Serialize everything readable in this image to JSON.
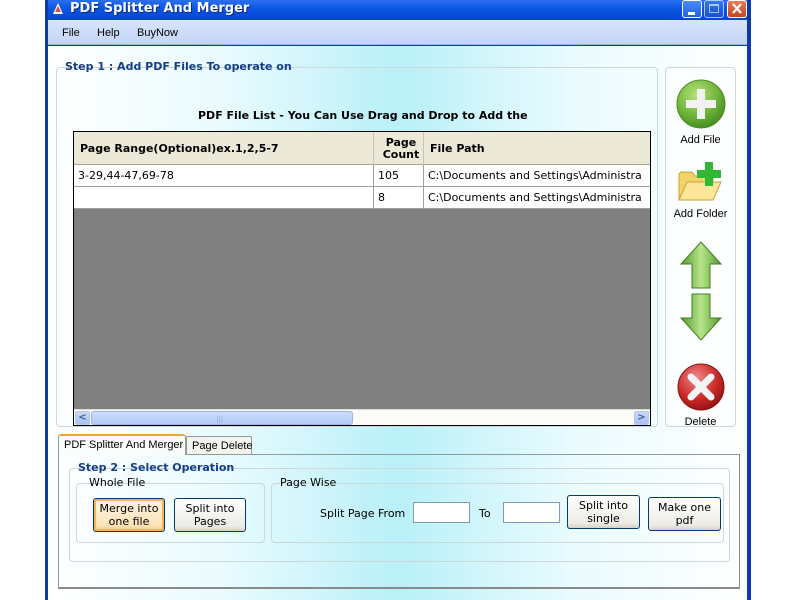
{
  "window": {
    "title": "PDF Splitter And Merger",
    "controls": [
      "minimize",
      "maximize",
      "close"
    ]
  },
  "menu": {
    "items": [
      "File",
      "Help",
      "BuyNow"
    ]
  },
  "step1": {
    "title": "Step 1 : Add PDF Files To operate on",
    "list_title": "PDF File List - You Can Use Drag and Drop to Add the",
    "columns": [
      "Page Range(Optional)ex.1,2,5-7",
      "Page Count",
      "File Path"
    ],
    "rows": [
      {
        "page_range": "3-29,44-47,69-78",
        "page_count": "105",
        "file_path": "C:\\Documents and Settings\\Administra"
      },
      {
        "page_range": "",
        "page_count": "8",
        "file_path": "C:\\Documents and Settings\\Administra"
      }
    ],
    "scrollbar": {
      "left_arrow": "<",
      "right_arrow": ">",
      "grip": "|||"
    }
  },
  "side_panel": {
    "add_file": "Add File",
    "add_folder": "Add Folder",
    "move_up": "",
    "move_down": "",
    "delete": "Delete"
  },
  "tabs": [
    {
      "label": "PDF Splitter And Merger",
      "active": true
    },
    {
      "label": "Page Delete",
      "active": false
    }
  ],
  "step2": {
    "title": "Step 2 : Select Operation",
    "whole_file": {
      "title": "Whole File",
      "merge_button": "Merge into one file",
      "split_button": "Split into Pages"
    },
    "page_wise": {
      "title": "Page Wise",
      "split_from_label": "Split Page From",
      "from_value": "",
      "to_label": "To",
      "to_value": "",
      "split_single_button": "Split into single",
      "make_one_button": "Make one pdf"
    }
  },
  "colors": {
    "titlebar": "#0a54e3",
    "group_title": "#123e8a",
    "grid_background": "#808080",
    "focus_button": "#f8b34f"
  }
}
